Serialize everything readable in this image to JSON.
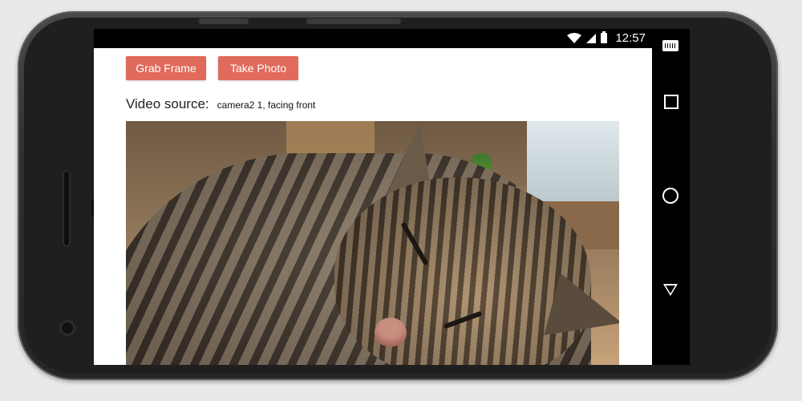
{
  "status_bar": {
    "time": "12:57",
    "icons": [
      "wifi-icon",
      "signal-icon",
      "battery-icon"
    ]
  },
  "toolbar": {
    "grab_frame_label": "Grab Frame",
    "take_photo_label": "Take Photo",
    "button_color": "#e06a5c"
  },
  "video_source": {
    "label": "Video source:",
    "value": "camera2 1, facing front"
  },
  "nav_bar": {
    "items": [
      "keyboard-icon",
      "recents-icon",
      "home-icon",
      "back-icon"
    ]
  }
}
